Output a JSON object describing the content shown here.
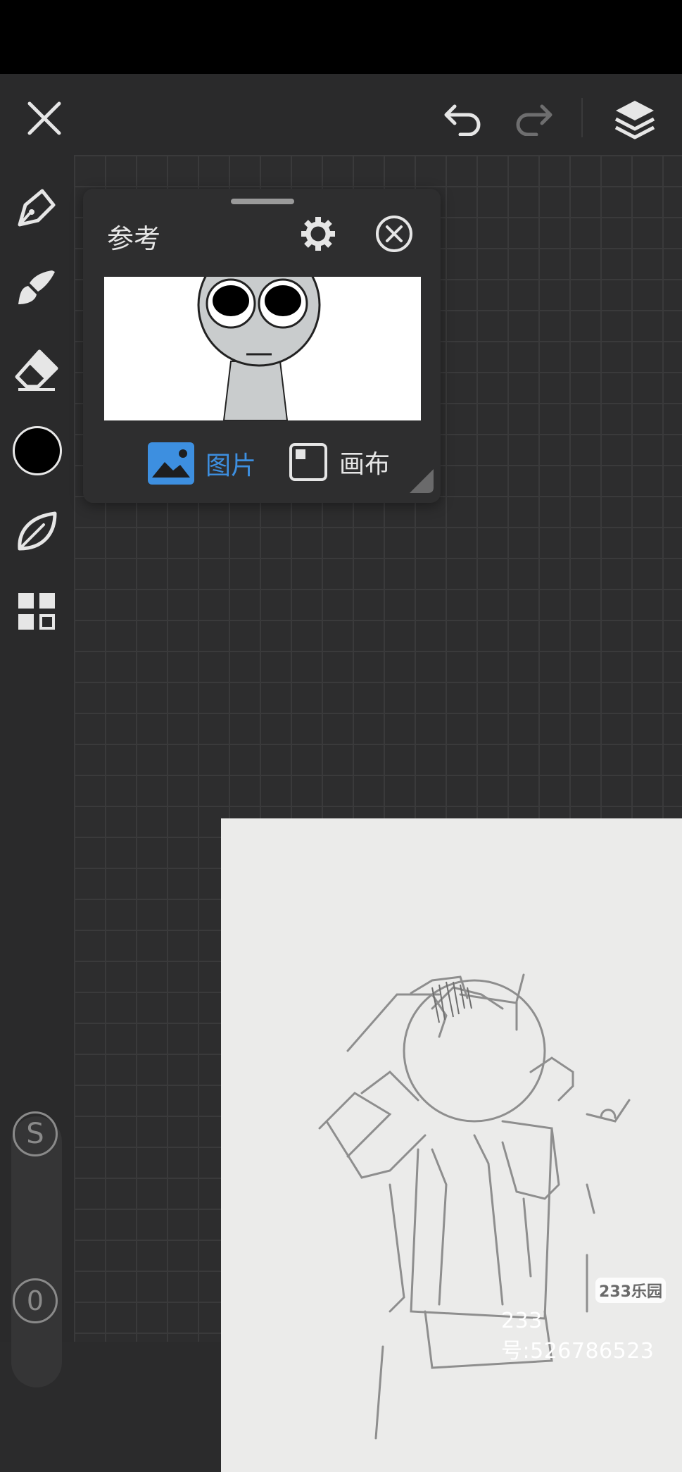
{
  "toolbar": {
    "close_icon": "close-icon",
    "undo_icon": "undo-icon",
    "redo_icon": "redo-icon",
    "layers_icon": "layers-icon"
  },
  "left_tools": {
    "items": [
      "pen-icon",
      "brush-icon",
      "eraser-icon",
      "color-swatch",
      "leaf-icon",
      "grid-icon"
    ],
    "current_color": "#000000",
    "stabilizer_label": "S",
    "opacity_label": "0"
  },
  "reference_panel": {
    "title": "参考",
    "tabs": [
      {
        "label": "图片",
        "active": true
      },
      {
        "label": "画布",
        "active": false
      }
    ]
  },
  "watermark": {
    "logo": "233乐园",
    "id_text": "233号:526786523"
  },
  "colors": {
    "accent": "#3d8fe0",
    "background": "#2b2b2c"
  }
}
